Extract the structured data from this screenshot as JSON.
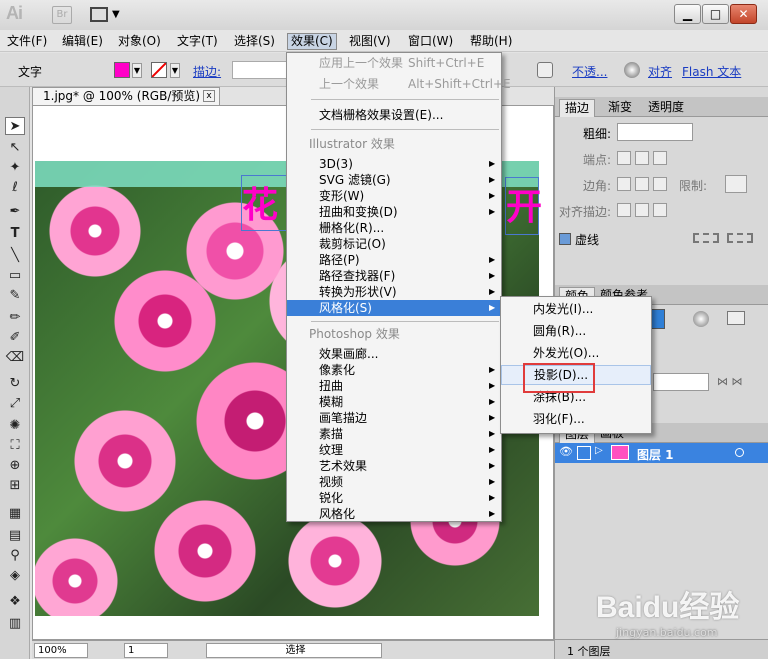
{
  "app": {
    "logo": "Ai",
    "bridge_badge": "Br",
    "win_min": "▁",
    "win_max": "□",
    "win_close": "✕"
  },
  "menubar": [
    {
      "label": "文件(F)"
    },
    {
      "label": "编辑(E)"
    },
    {
      "label": "对象(O)"
    },
    {
      "label": "文字(T)"
    },
    {
      "label": "选择(S)"
    },
    {
      "label": "效果(C)"
    },
    {
      "label": "视图(V)"
    },
    {
      "label": "窗口(W)"
    },
    {
      "label": "帮助(H)"
    }
  ],
  "control_bar": {
    "context_label": "文字",
    "fill_color": "#ff00c8",
    "stroke_label": "描边:",
    "opacity_link": "不透...",
    "align_link": "对齐",
    "flash_link": "Flash 文本"
  },
  "document": {
    "tab_title": "1.jpg* @ 100% (RGB/预览)",
    "tab_close": "x",
    "text_obj_1": "花",
    "text_obj_2": "开"
  },
  "status_bar": {
    "zoom": "100%",
    "artboard": "1",
    "tool_status": "选择"
  },
  "effect_menu": {
    "apply_last": "应用上一个效果",
    "apply_last_shortcut": "Shift+Ctrl+E",
    "last_effect": "上一个效果",
    "last_effect_shortcut": "Alt+Shift+Ctrl+E",
    "raster_settings": "文档栅格效果设置(E)...",
    "illustrator_header": "Illustrator 效果",
    "illustrator_items": [
      "3D(3)",
      "SVG 滤镜(G)",
      "变形(W)",
      "扭曲和变换(D)",
      "栅格化(R)...",
      "裁剪标记(O)",
      "路径(P)",
      "路径查找器(F)",
      "转换为形状(V)",
      "风格化(S)"
    ],
    "photoshop_header": "Photoshop 效果",
    "photoshop_items": [
      "效果画廊...",
      "像素化",
      "扭曲",
      "模糊",
      "画笔描边",
      "素描",
      "纹理",
      "艺术效果",
      "视频",
      "锐化",
      "风格化"
    ]
  },
  "stylize_submenu": [
    "内发光(I)...",
    "圆角(R)...",
    "外发光(O)...",
    "投影(D)...",
    "涂抹(B)...",
    "羽化(F)..."
  ],
  "right_panel": {
    "stroke_tabs": [
      "描边",
      "渐变",
      "透明度"
    ],
    "weight_label": "粗细:",
    "cap_label": "端点:",
    "corner_label": "边角:",
    "limit_label": "限制:",
    "align_stroke_label": "对齐描边:",
    "dashed_label": "虚线",
    "color_tabs": [
      "颜色",
      "颜色参考"
    ],
    "layer_tabs": [
      "图层",
      "画板"
    ],
    "layer_name": "图层 1",
    "layers_count": "1 个图层"
  },
  "watermark": {
    "text": "Baidu经验",
    "url": "jingyan.baidu.com"
  }
}
